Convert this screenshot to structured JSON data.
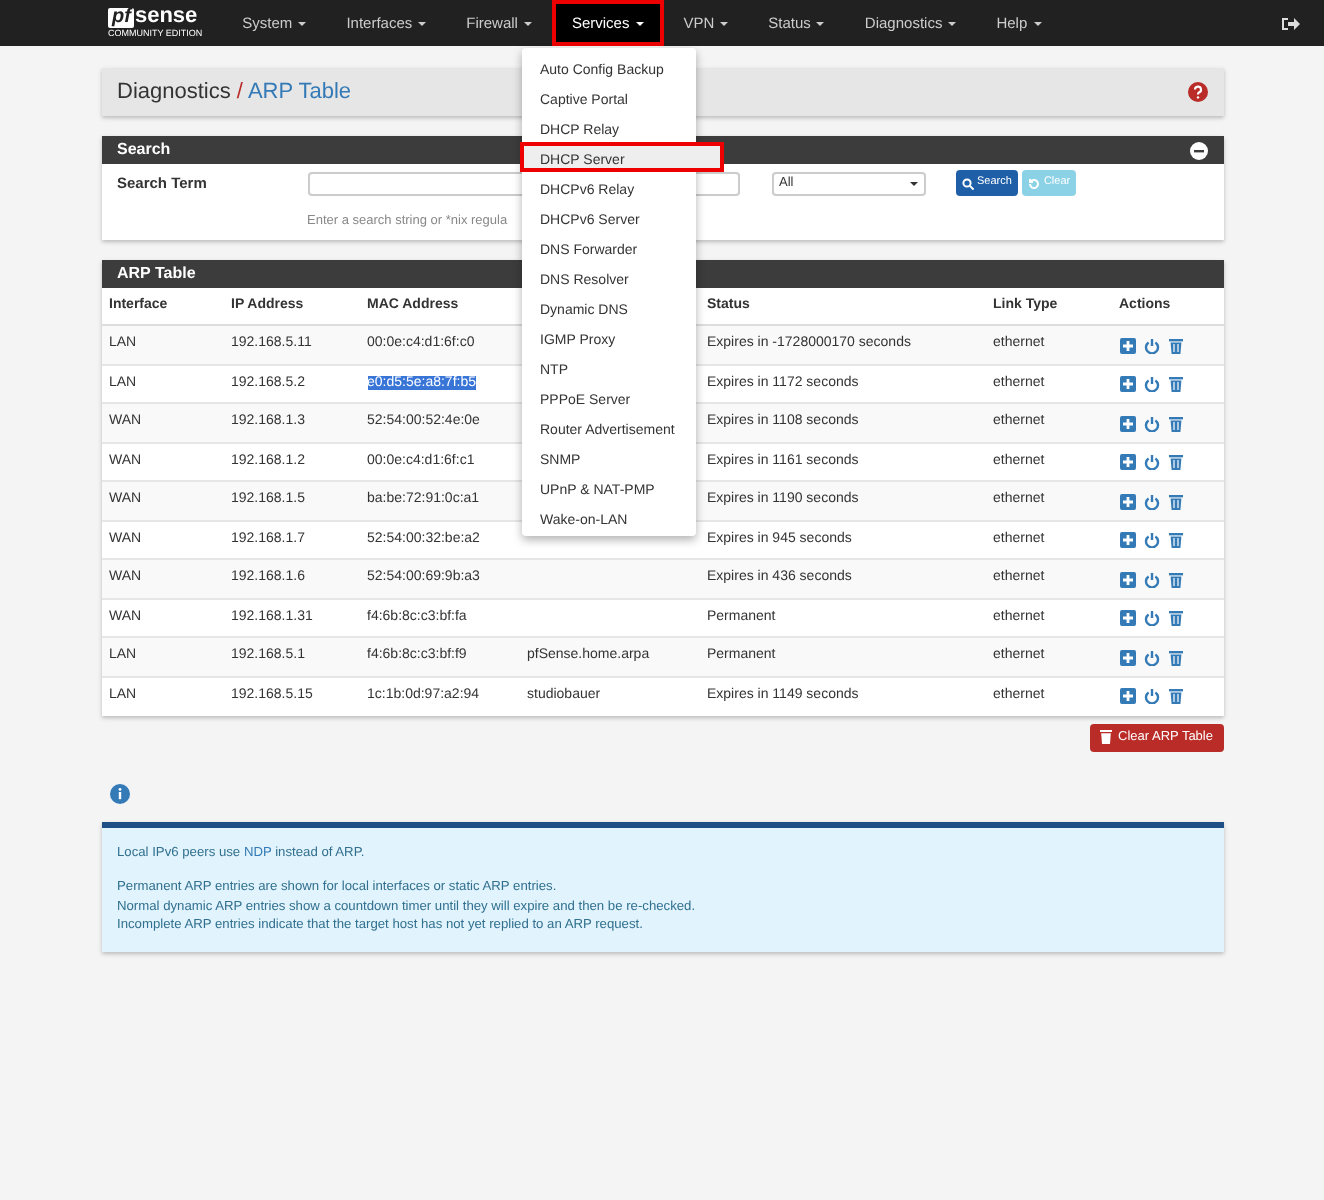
{
  "navbar": {
    "logo_mark": "pf",
    "logo_word": "sense",
    "logo_sub": "COMMUNITY EDITION",
    "menus": [
      {
        "label": "System",
        "selected": false,
        "annotated": false
      },
      {
        "label": "Interfaces",
        "selected": false,
        "annotated": false
      },
      {
        "label": "Firewall",
        "selected": false,
        "annotated": false
      },
      {
        "label": "Services",
        "selected": true,
        "annotated": true
      },
      {
        "label": "VPN",
        "selected": false,
        "annotated": false
      },
      {
        "label": "Status",
        "selected": false,
        "annotated": false
      },
      {
        "label": "Diagnostics",
        "selected": false,
        "annotated": false
      },
      {
        "label": "Help",
        "selected": false,
        "annotated": false
      }
    ]
  },
  "services_menu": {
    "items": [
      {
        "label": "Auto Config Backup",
        "annotated": false
      },
      {
        "label": "Captive Portal",
        "annotated": false
      },
      {
        "label": "DHCP Relay",
        "annotated": false
      },
      {
        "label": "DHCP Server",
        "annotated": true
      },
      {
        "label": "DHCPv6 Relay",
        "annotated": false
      },
      {
        "label": "DHCPv6 Server",
        "annotated": false
      },
      {
        "label": "DNS Forwarder",
        "annotated": false
      },
      {
        "label": "DNS Resolver",
        "annotated": false
      },
      {
        "label": "Dynamic DNS",
        "annotated": false
      },
      {
        "label": "IGMP Proxy",
        "annotated": false
      },
      {
        "label": "NTP",
        "annotated": false
      },
      {
        "label": "PPPoE Server",
        "annotated": false
      },
      {
        "label": "Router Advertisement",
        "annotated": false
      },
      {
        "label": "SNMP",
        "annotated": false
      },
      {
        "label": "UPnP & NAT-PMP",
        "annotated": false
      },
      {
        "label": "Wake-on-LAN",
        "annotated": false
      }
    ]
  },
  "breadcrumb": {
    "parent": "Diagnostics",
    "separator": "/",
    "current": "ARP Table"
  },
  "search": {
    "title": "Search",
    "label": "Search Term",
    "scope": "All",
    "search_button": "Search",
    "clear_button": "Clear",
    "help": "Enter a search string or *nix regula"
  },
  "table": {
    "title": "ARP Table",
    "columns": [
      "Interface",
      "IP Address",
      "MAC Address",
      "Status",
      "Link Type",
      "Actions"
    ],
    "rows": [
      {
        "interface": "LAN",
        "ip": "192.168.5.11",
        "mac": "00:0e:c4:d1:6f:c0",
        "mac_selected": false,
        "status": "Expires in -1728000170 seconds",
        "link_type": "ethernet"
      },
      {
        "interface": "LAN",
        "ip": "192.168.5.2",
        "mac": "e0:d5:5e:a8:7f:b5",
        "mac_selected": true,
        "status": "Expires in 1172 seconds",
        "link_type": "ethernet"
      },
      {
        "interface": "WAN",
        "ip": "192.168.1.3",
        "mac": "52:54:00:52:4e:0e",
        "mac_selected": false,
        "status": "Expires in 1108 seconds",
        "link_type": "ethernet"
      },
      {
        "interface": "WAN",
        "ip": "192.168.1.2",
        "mac": "00:0e:c4:d1:6f:c1",
        "mac_selected": false,
        "status": "Expires in 1161 seconds",
        "link_type": "ethernet"
      },
      {
        "interface": "WAN",
        "ip": "192.168.1.5",
        "mac": "ba:be:72:91:0c:a1",
        "mac_selected": false,
        "status": "Expires in 1190 seconds",
        "link_type": "ethernet"
      },
      {
        "interface": "WAN",
        "ip": "192.168.1.7",
        "mac": "52:54:00:32:be:a2",
        "mac_selected": false,
        "status": "Expires in 945 seconds",
        "link_type": "ethernet"
      },
      {
        "interface": "WAN",
        "ip": "192.168.1.6",
        "mac": "52:54:00:69:9b:a3",
        "mac_selected": false,
        "status": "Expires in 436 seconds",
        "link_type": "ethernet"
      },
      {
        "interface": "WAN",
        "ip": "192.168.1.31",
        "mac": "f4:6b:8c:c3:bf:fa",
        "mac_selected": false,
        "status": "Permanent",
        "link_type": "ethernet"
      },
      {
        "interface": "LAN",
        "ip": "192.168.5.1",
        "mac": "f4:6b:8c:c3:bf:f9",
        "mac_selected": false,
        "hostname": "pfSense.home.arpa",
        "status": "Permanent",
        "link_type": "ethernet"
      },
      {
        "interface": "LAN",
        "ip": "192.168.5.15",
        "mac": "1c:1b:0d:97:a2:94",
        "mac_selected": false,
        "hostname": "studiobauer",
        "status": "Expires in 1149 seconds",
        "link_type": "ethernet"
      }
    ]
  },
  "clear_table_button": "Clear ARP Table",
  "info": {
    "line_1_before": "Local IPv6 peers use",
    "line_1_link": "NDP",
    "line_1_after": "instead of ARP.",
    "lines": [
      "Permanent ARP entries are shown for local interfaces or static ARP entries.",
      "Normal dynamic ARP entries show a countdown timer until they will expire and then be re-checked.",
      "Incomplete ARP entries indicate that the target host has not yet replied to an ARP request."
    ]
  }
}
